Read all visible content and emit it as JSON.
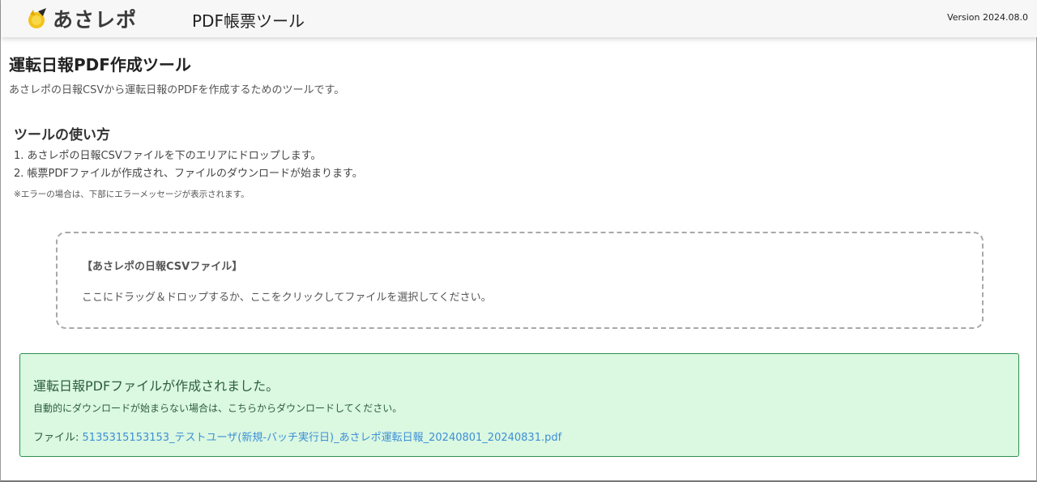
{
  "header": {
    "logo_text": "あさレポ",
    "logo_icon": "asarepo-logo-icon",
    "tool_title": "PDF帳票ツール",
    "version": "Version 2024.08.0"
  },
  "page": {
    "title": "運転日報PDF作成ツール",
    "description": "あさレポの日報CSVから運転日報のPDFを作成するためのツールです。"
  },
  "howto": {
    "title": "ツールの使い方",
    "steps": [
      "1. あさレポの日報CSVファイルを下のエリアにドロップします。",
      "2. 帳票PDFファイルが作成され、ファイルのダウンロードが始まります。"
    ],
    "note": "※エラーの場合は、下部にエラーメッセージが表示されます。"
  },
  "dropzone": {
    "title": "【あさレポの日報CSVファイル】",
    "hint": "ここにドラッグ＆ドロップするか、ここをクリックしてファイルを選択してください。"
  },
  "result": {
    "title": "運転日報PDFファイルが作成されました。",
    "subtitle": "自動的にダウンロードが始まらない場合は、こちらからダウンロードしてください。",
    "file_label": "ファイル:",
    "file_name": "5135315153153_テストユーザ(新規-バッチ実行日)_あさレポ運転日報_20240801_20240831.pdf"
  },
  "colors": {
    "success_bg": "#dbf8e1",
    "success_border": "#2f8f4e",
    "link": "#3d8fd6"
  }
}
